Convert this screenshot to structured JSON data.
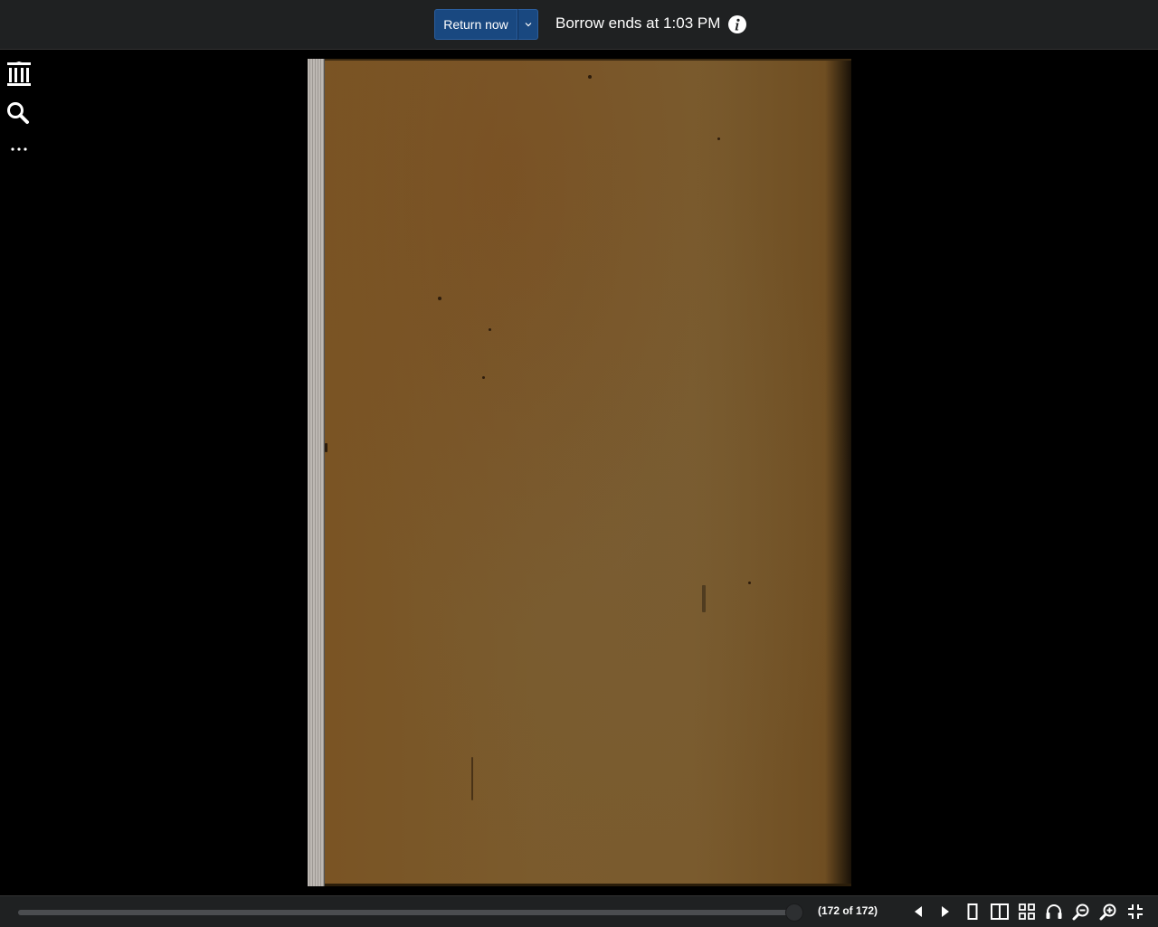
{
  "topbar": {
    "return_label": "Return now",
    "borrow_text": "Borrow ends at 1:03 PM",
    "info_icon": "info-icon",
    "caret_icon": "chevron-down-icon",
    "accent_color": "#194880"
  },
  "sidebar": {
    "items": [
      {
        "icon": "archive-building-icon",
        "label": ""
      },
      {
        "icon": "search-icon",
        "label": ""
      },
      {
        "icon": "more-icon",
        "label": ""
      }
    ]
  },
  "viewer": {
    "page_current": 172,
    "page_total": 172,
    "page_indicator": "(172 of 172)",
    "progress_fraction": 1.0
  },
  "toolbar": {
    "icons": [
      "previous-page-icon",
      "next-page-icon",
      "one-page-view-icon",
      "two-page-view-icon",
      "thumbnail-view-icon",
      "read-aloud-icon",
      "zoom-out-icon",
      "zoom-in-icon",
      "exit-fullscreen-icon"
    ]
  }
}
